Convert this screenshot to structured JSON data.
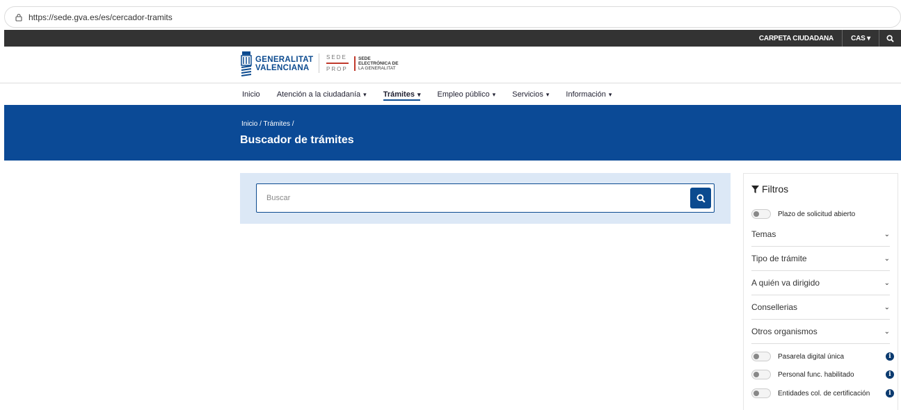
{
  "browser": {
    "url": "https://sede.gva.es/es/cercador-tramits"
  },
  "topbar": {
    "carpeta": "CARPETA CIUDADANA",
    "lang": "CAS",
    "lang_chev": "▾"
  },
  "logo": {
    "line1": "GENERALITAT",
    "line2": "VALENCIANA",
    "sede_top": "SEDE",
    "sede_bottom": "PROP",
    "se_line1": "SEDE",
    "se_line2": "ELECTRÓNICA DE",
    "se_line3": "LA GENERALITAT"
  },
  "nav": {
    "items": [
      {
        "label": "Inicio",
        "chev": ""
      },
      {
        "label": "Atención a la ciudadanía",
        "chev": "▾"
      },
      {
        "label": "Trámites",
        "chev": "▾"
      },
      {
        "label": "Empleo público",
        "chev": "▾"
      },
      {
        "label": "Servicios",
        "chev": "▾"
      },
      {
        "label": "Información",
        "chev": "▾"
      }
    ]
  },
  "banner": {
    "breadcrumb": "Inicio  /  Trámites  /",
    "title": "Buscador de trámites"
  },
  "search": {
    "placeholder": "Buscar"
  },
  "filters": {
    "title": "Filtros",
    "plazo": "Plazo de solicitud abierto",
    "accordions": [
      {
        "label": "Temas"
      },
      {
        "label": "Tipo de trámite"
      },
      {
        "label": "A quién va dirigido"
      },
      {
        "label": "Consellerias"
      },
      {
        "label": "Otros organismos"
      }
    ],
    "toggles": [
      {
        "label": "Pasarela digital única"
      },
      {
        "label": "Personal func. habilitado"
      },
      {
        "label": "Entidades col. de certificación"
      }
    ],
    "info_glyph": "i",
    "chev": "⌄"
  }
}
